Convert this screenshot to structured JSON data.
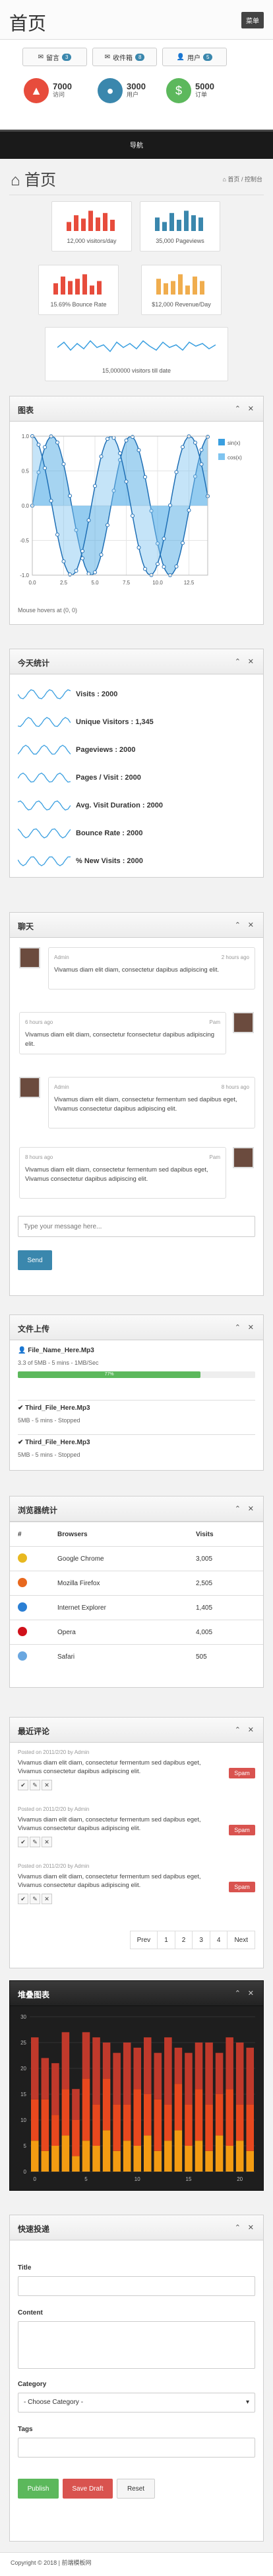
{
  "topbar": {
    "logo": "首页",
    "menu_button": "菜单"
  },
  "quick_buttons": [
    {
      "label": "留言",
      "badge": "3"
    },
    {
      "label": "收件箱",
      "badge": "8"
    },
    {
      "label": "用户",
      "badge": "5"
    }
  ],
  "stats": [
    {
      "value": "7000",
      "label": "访问",
      "color": "#e74c3c",
      "icon": "fire-icon"
    },
    {
      "value": "3000",
      "label": "用户",
      "color": "#3a87ad",
      "icon": "user-icon"
    },
    {
      "value": "5000",
      "label": "订单",
      "color": "#5cb85c",
      "icon": "money-icon"
    }
  ],
  "navbar": {
    "title": "导航"
  },
  "page": {
    "title": "首页",
    "crumb_home": "首页",
    "crumb_sep": "/",
    "crumb_current": "控制台"
  },
  "quick_stats": [
    {
      "label": "12,000 visitors/day",
      "color": "#e74c3c",
      "bars": [
        0.4,
        0.7,
        0.55,
        0.9,
        0.6,
        0.8,
        0.5
      ]
    },
    {
      "label": "35,000 Pageviews",
      "color": "#3a87ad",
      "bars": [
        0.6,
        0.4,
        0.8,
        0.5,
        0.9,
        0.7,
        0.6
      ]
    },
    {
      "label": "15.69% Bounce Rate",
      "color": "#e74c3c",
      "bars": [
        0.5,
        0.8,
        0.6,
        0.7,
        0.9,
        0.4,
        0.6
      ]
    },
    {
      "label": "$12,000 Revenue/Day",
      "color": "#f0ad4e",
      "bars": [
        0.7,
        0.5,
        0.6,
        0.9,
        0.4,
        0.8,
        0.6
      ]
    },
    {
      "label": "15,000000 visitors till date"
    }
  ],
  "chart_box": {
    "title": "图表",
    "footer": "Mouse hovers at (0, 0)",
    "legend": [
      "sin(x)",
      "cos(x)"
    ]
  },
  "chart_data": {
    "type": "area",
    "title": "",
    "xlabel": "",
    "ylabel": "",
    "xlim": [
      0,
      14
    ],
    "ylim": [
      -1,
      1
    ],
    "xticks": [
      "0.0",
      "2.5",
      "5.0",
      "7.5",
      "10.0",
      "12.5"
    ],
    "yticks": [
      "1.0",
      "0.5",
      "0.0",
      "-0.5",
      "-1.0"
    ],
    "series": [
      {
        "name": "sin(x)",
        "color": "#3a9fe0"
      },
      {
        "name": "cos(x)",
        "color": "#7fc4f0"
      }
    ]
  },
  "today": {
    "title": "今天统计",
    "items": [
      "Visits : 2000",
      "Unique Visitors : 1,345",
      "Pageviews : 2000",
      "Pages / Visit : 2000",
      "Avg. Visit Duration : 2000",
      "Bounce Rate : 2000",
      "% New Visits : 2000"
    ]
  },
  "chat": {
    "title": "聊天",
    "messages": [
      {
        "name": "Admin",
        "time": "2 hours ago",
        "text": "Vivamus diam elit diam, consectetur dapibus adipiscing elit.",
        "side": "left"
      },
      {
        "name": "Pam",
        "time": "6 hours ago",
        "text": "Vivamus diam elit diam, consectetur fconsectetur dapibus adipiscing elit.",
        "side": "right"
      },
      {
        "name": "Admin",
        "time": "8 hours ago",
        "text": "Vivamus diam elit diam, consectetur fermentum sed dapibus eget, Vivamus consectetur dapibus adipiscing elit.",
        "side": "left"
      },
      {
        "name": "Pam",
        "time": "8 hours ago",
        "text": "Vivamus diam elit diam, consectetur fermentum sed dapibus eget, Vivamus consectetur dapibus adipiscing elit.",
        "side": "right"
      }
    ],
    "placeholder": "Type your message here...",
    "send": "Send"
  },
  "uploads": {
    "title": "文件上传",
    "files": [
      {
        "name": "File_Name_Here.Mp3",
        "status": "3.3 of 5MB - 5 mins - 1MB/Sec",
        "progress": "77%"
      },
      {
        "name": "Third_File_Here.Mp3",
        "status": "5MB - 5 mins - Stopped"
      },
      {
        "name": "Third_File_Here.Mp3",
        "status": "5MB - 5 mins - Stopped"
      }
    ]
  },
  "browsers": {
    "title": "浏览器统计",
    "headers": [
      "#",
      "Browsers",
      "Visits"
    ],
    "rows": [
      {
        "name": "Google Chrome",
        "visits": "3,005",
        "color": "#e8b820"
      },
      {
        "name": "Mozilla Firefox",
        "visits": "2,505",
        "color": "#e8681e"
      },
      {
        "name": "Internet Explorer",
        "visits": "1,405",
        "color": "#2b7fd4"
      },
      {
        "name": "Opera",
        "visits": "4,005",
        "color": "#d0111b"
      },
      {
        "name": "Safari",
        "visits": "505",
        "color": "#6aa7e0"
      }
    ]
  },
  "comments": {
    "title": "最近评论",
    "items": [
      {
        "by": "Posted on 2011/2/20 by Admin",
        "text": "Vivamus diam elit diam, consectetur fermentum sed dapibus eget, Vivamus consectetur dapibus adipiscing elit."
      },
      {
        "by": "Posted on 2011/2/20 by Admin",
        "text": "Vivamus diam elit diam, consectetur fermentum sed dapibus eget, Vivamus consectetur dapibus adipiscing elit."
      },
      {
        "by": "Posted on 2011/2/20 by Admin",
        "text": "Vivamus diam elit diam, consectetur fermentum sed dapibus eget, Vivamus consectetur dapibus adipiscing elit."
      }
    ],
    "spam": "Spam",
    "pager": [
      "Prev",
      "1",
      "2",
      "3",
      "4",
      "Next"
    ]
  },
  "dark_chart": {
    "title": "堆叠图表",
    "xticks": [
      "0",
      "5",
      "10",
      "15",
      "20"
    ],
    "yticks": [
      "30",
      "25",
      "20",
      "15",
      "10",
      "5",
      "0"
    ]
  },
  "dark_chart_data": {
    "type": "bar",
    "stacked": true,
    "ylim": [
      0,
      30
    ],
    "series": [
      {
        "name": "",
        "color": "#f39c12",
        "values": [
          6,
          4,
          5,
          7,
          3,
          6,
          5,
          8,
          4,
          6,
          5,
          7,
          4,
          6,
          8,
          5,
          6,
          4,
          7,
          5,
          6,
          4
        ]
      },
      {
        "name": "",
        "color": "#e8481e",
        "values": [
          8,
          10,
          6,
          9,
          7,
          12,
          8,
          10,
          9,
          7,
          11,
          8,
          10,
          7,
          9,
          8,
          10,
          9,
          8,
          11,
          7,
          9
        ]
      },
      {
        "name": "",
        "color": "#c0392b",
        "values": [
          12,
          8,
          10,
          11,
          6,
          9,
          13,
          7,
          10,
          12,
          8,
          11,
          9,
          13,
          7,
          10,
          9,
          12,
          8,
          10,
          12,
          11
        ]
      }
    ]
  },
  "post": {
    "title": "快速投递",
    "title_label": "Title",
    "content_label": "Content",
    "category_label": "Category",
    "category_value": "- Choose Category -",
    "tags_label": "Tags",
    "publish": "Publish",
    "draft": "Save Draft",
    "reset": "Reset"
  },
  "footer": {
    "text": "Copyright © 2018 | 前端模板网"
  }
}
